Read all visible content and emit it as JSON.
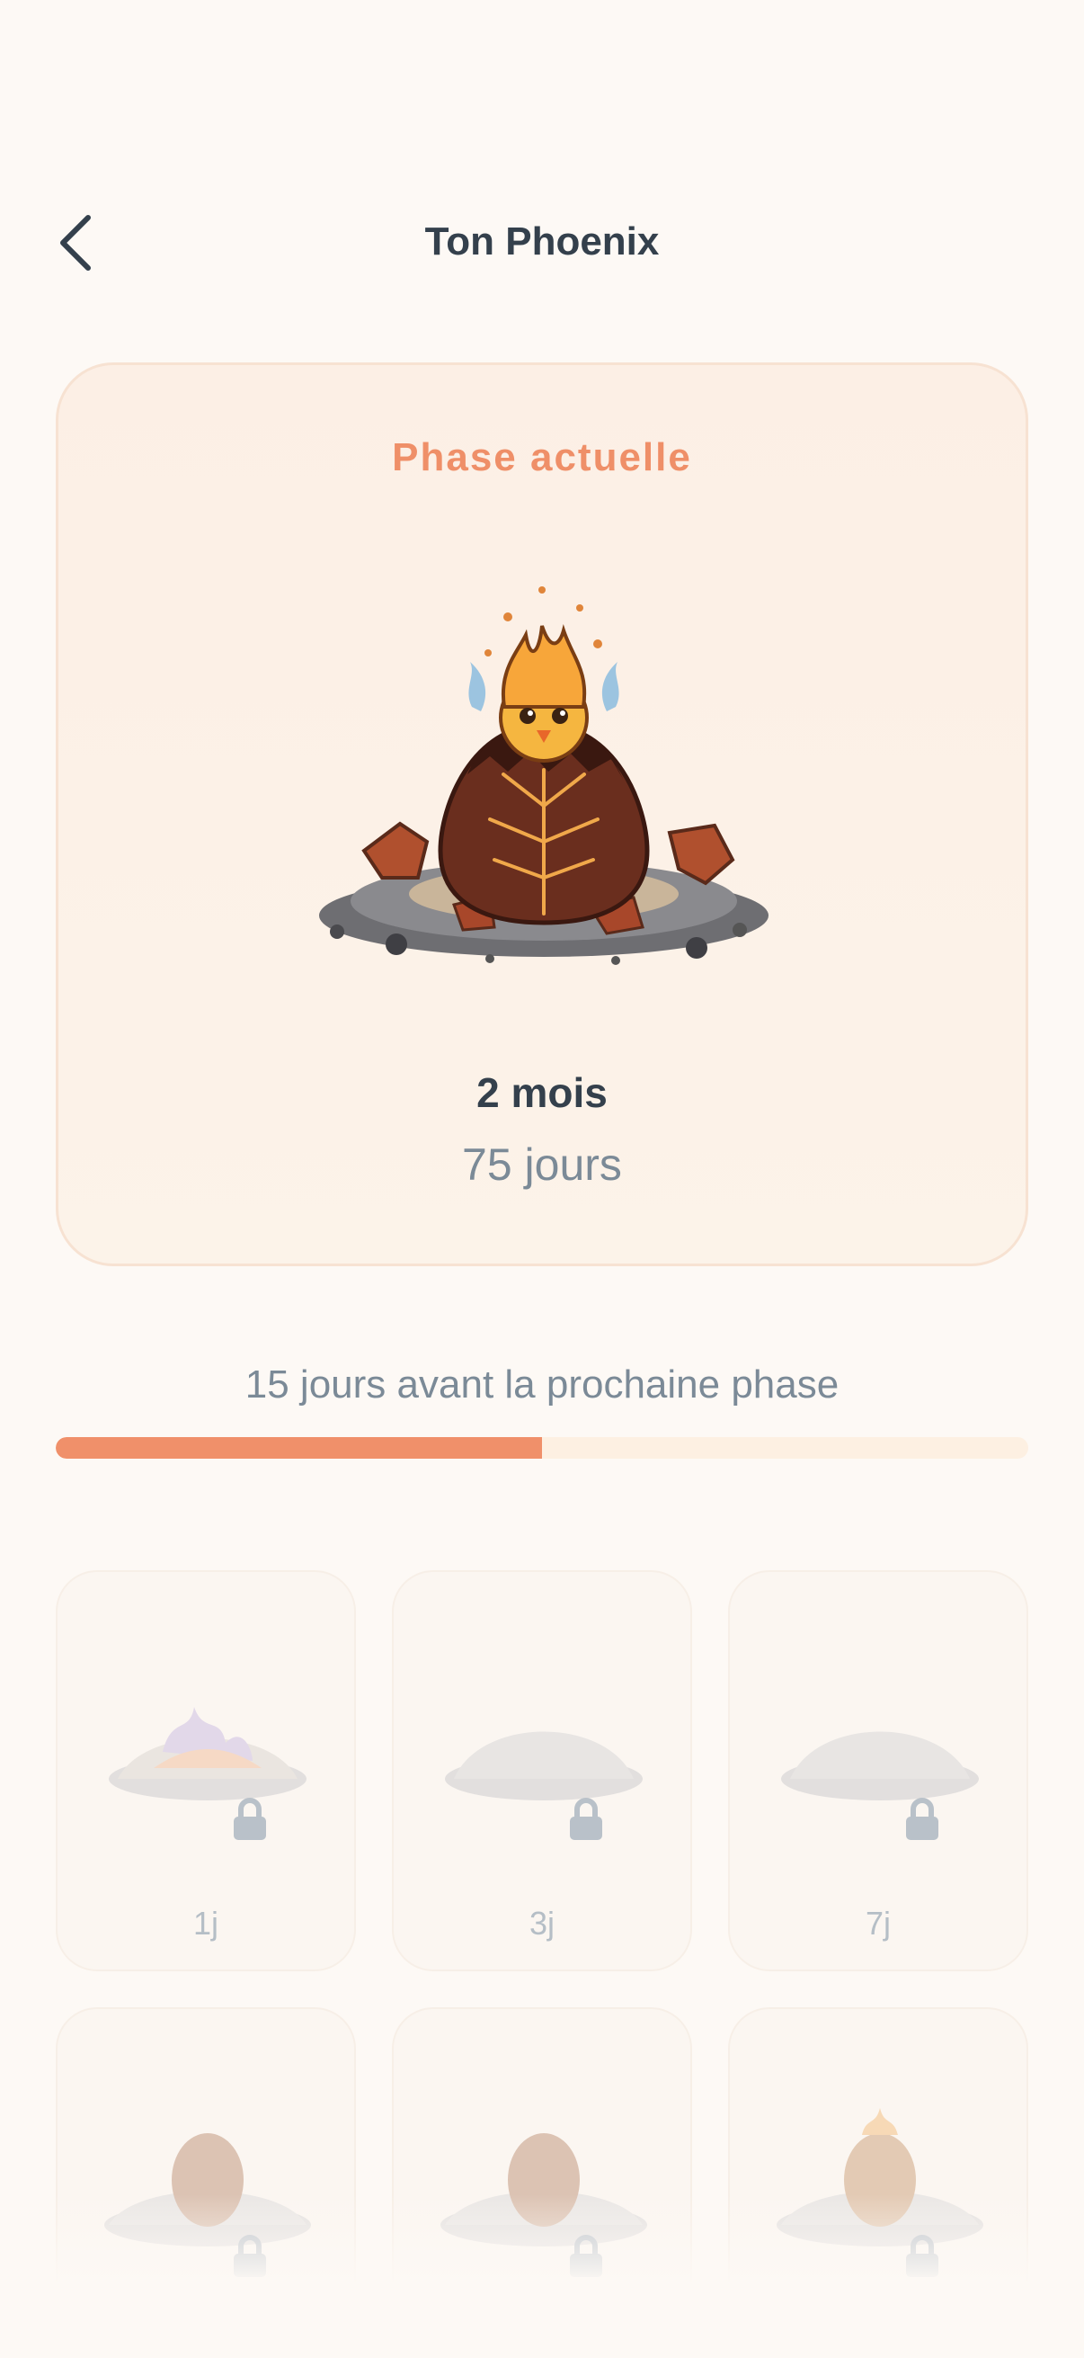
{
  "header": {
    "title": "Ton Phoenix"
  },
  "current_phase": {
    "label": "Phase actuelle",
    "months": "2 mois",
    "days": "75 jours",
    "image": "phoenix-hatching-egg"
  },
  "progress": {
    "text": "15 jours avant la prochaine phase",
    "fraction": 0.5
  },
  "milestones": [
    {
      "label": "1j",
      "locked": true
    },
    {
      "label": "3j",
      "locked": true
    },
    {
      "label": "7j",
      "locked": true
    },
    {
      "label": "",
      "locked": true
    },
    {
      "label": "",
      "locked": true
    },
    {
      "label": "",
      "locked": true
    }
  ],
  "colors": {
    "accent": "#f0906a",
    "progress_track": "#fdf0e2",
    "background": "#fdf9f5"
  }
}
